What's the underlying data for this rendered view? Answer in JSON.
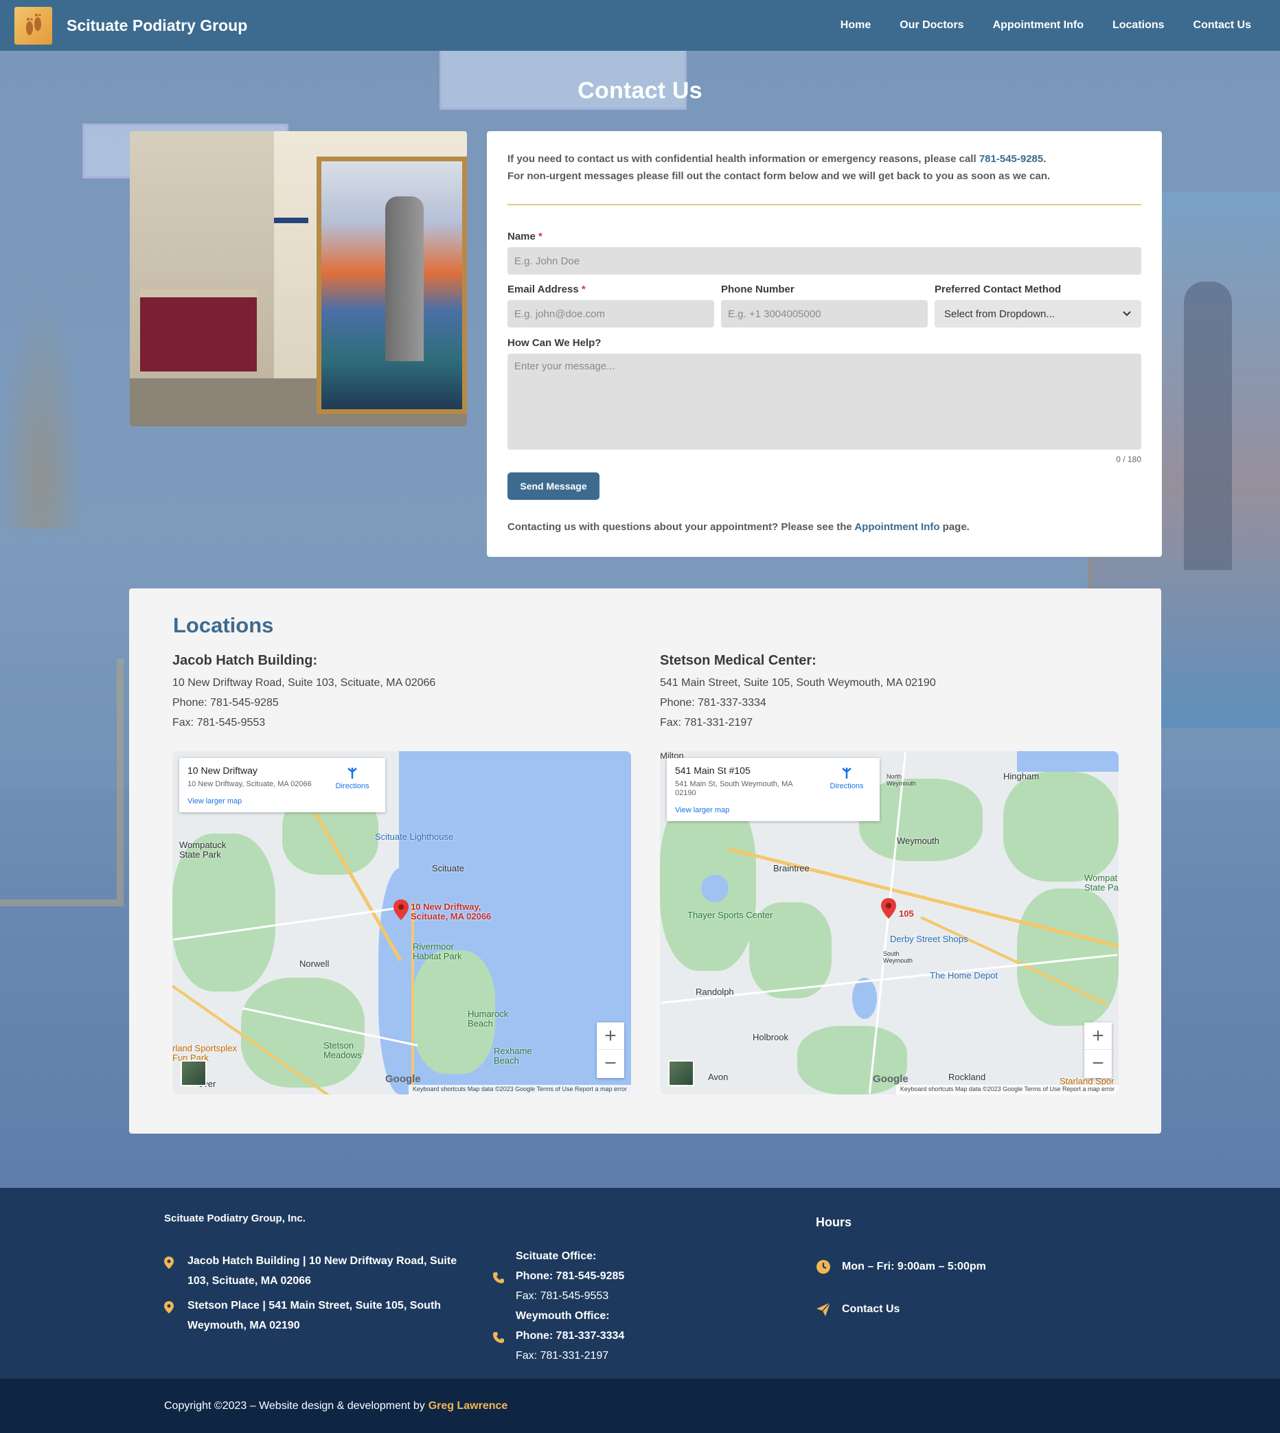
{
  "header": {
    "brand": "Scituate Podiatry Group",
    "nav": [
      "Home",
      "Our Doctors",
      "Appointment Info",
      "Locations",
      "Contact Us"
    ]
  },
  "page": {
    "title": "Contact Us"
  },
  "contact": {
    "intro_line1_prefix": "If you need to contact us with confidential health information or emergency reasons, please call ",
    "intro_phone": "781-545-9285",
    "intro_line1_suffix": ".",
    "intro_line2": "For non-urgent messages please fill out the contact form below and we will get back to you as soon as we can.",
    "form": {
      "name_label": "Name",
      "name_placeholder": "E.g. John Doe",
      "email_label": "Email Address",
      "email_placeholder": "E.g. john@doe.com",
      "phone_label": "Phone Number",
      "phone_placeholder": "E.g. +1 3004005000",
      "method_label": "Preferred Contact Method",
      "method_value": "Select from Dropdown...",
      "message_label": "How Can We Help?",
      "message_placeholder": "Enter your message...",
      "counter": "0 / 180",
      "required_mark": "*",
      "send_label": "Send Message"
    },
    "appt_prefix": "Contacting us with questions about your appointment? Please see the ",
    "appt_link": "Appointment Info",
    "appt_suffix": " page."
  },
  "locations": {
    "title": "Locations",
    "items": [
      {
        "name": "Jacob Hatch Building:",
        "address": "10 New Driftway Road, Suite 103, Scituate, MA 02066",
        "phone": "Phone: 781-545-9285",
        "fax": "Fax: 781-545-9553",
        "map": {
          "info_title": "10 New Driftway",
          "info_sub": "10 New Driftway, Scituate, MA 02066",
          "directions": "Directions",
          "larger": "View larger map",
          "pin_label": "10 New Driftway, Scituate, MA 02066",
          "places": [
            "Scituate Lighthouse",
            "Scituate",
            "Wompatuck State Park",
            "Rivermoor Habitat Park",
            "Norwell",
            "Humarock Beach",
            "Stetson Meadows",
            "Rexhame Beach",
            "rland Sportsplex Fun Park",
            "over"
          ],
          "attribution": "Keyboard shortcuts   Map data ©2023 Google   Terms of Use   Report a map error",
          "google": "Google"
        }
      },
      {
        "name": "Stetson Medical Center:",
        "address": "541 Main Street, Suite 105, South Weymouth, MA 02190",
        "phone": "Phone: 781-337-3334",
        "fax": "Fax: 781-331-2197",
        "map": {
          "info_title": "541 Main St #105",
          "info_sub": "541 Main St, South Weymouth, MA 02190",
          "directions": "Directions",
          "larger": "View larger map",
          "pin_label": "105",
          "places": [
            "Hingham",
            "North Weymouth",
            "Weymouth",
            "Braintree",
            "Wompat State Pa",
            "Thayer Sports Center",
            "Derby Street Shops",
            "South Weymouth",
            "The Home Depot",
            "Randolph",
            "Holbrook",
            "Avon",
            "Rockland",
            "Starland Spor",
            "Milton"
          ],
          "attribution": "Keyboard shortcuts   Map data ©2023 Google   Terms of Use   Report a map error",
          "google": "Google"
        }
      }
    ]
  },
  "footer": {
    "company": "Scituate Podiatry Group, Inc.",
    "addresses": [
      "Jacob Hatch Building | 10 New Driftway Road, Suite 103, Scituate, MA 02066",
      "Stetson Place | 541 Main Street, Suite 105, South Weymouth, MA 02190"
    ],
    "scituate": {
      "title": "Scituate Office:",
      "phone": "Phone: 781-545-9285",
      "fax": "Fax: 781-545-9553"
    },
    "weymouth": {
      "title": "Weymouth Office:",
      "phone": "Phone: 781-337-3334",
      "fax": "Fax: 781-331-2197"
    },
    "hours_title": "Hours",
    "hours": "Mon – Fri: 9:00am – 5:00pm",
    "contact_link": "Contact Us",
    "copyright_prefix": "Copyright ©2023 – Website design & development by",
    "copyright_author": "Greg Lawrence"
  },
  "colors": {
    "header": "#3d6b8f",
    "footer": "#1d3a5e",
    "footer_bottom": "#0f2544",
    "accent": "#f0b755",
    "link": "#3d6b8f"
  }
}
